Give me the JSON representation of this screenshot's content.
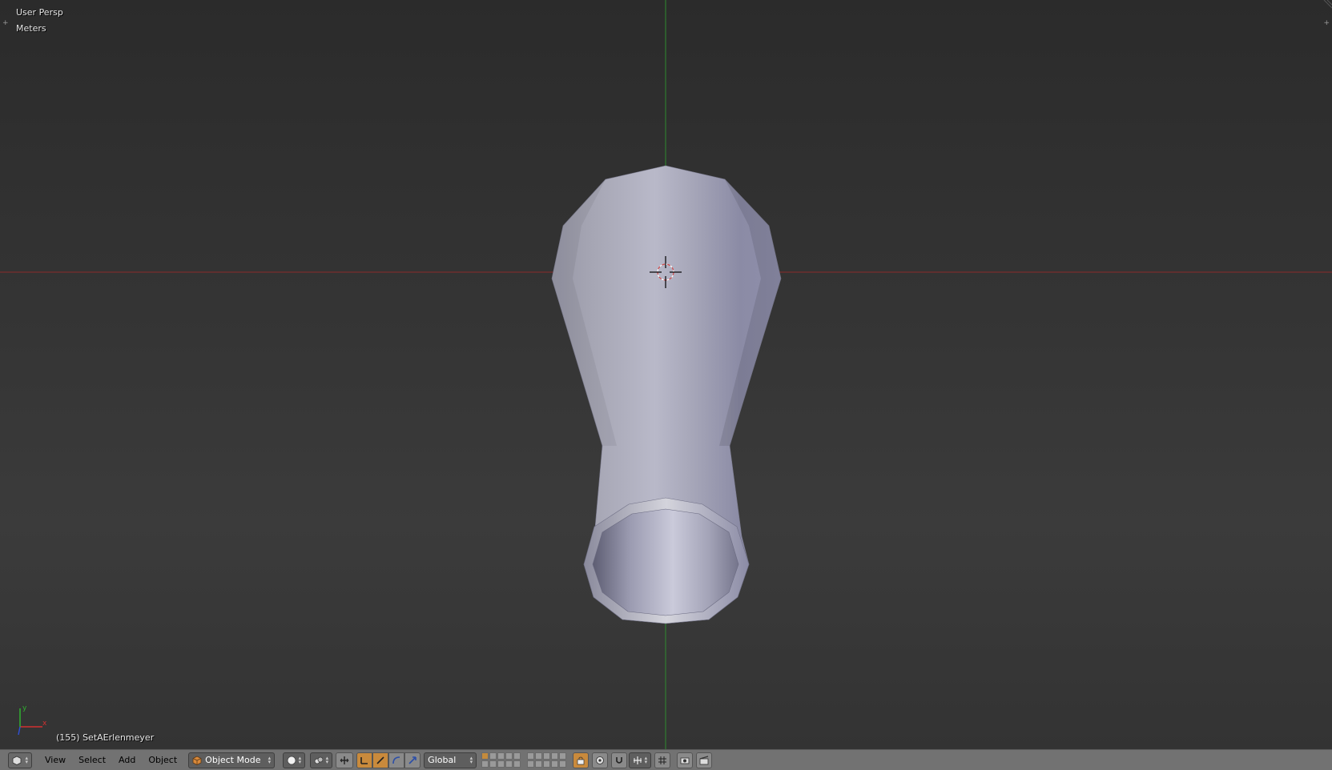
{
  "viewport": {
    "view_name": "User Persp",
    "units": "Meters",
    "object_info": "(155) SetAErlenmeyer",
    "axis_labels": {
      "x": "x",
      "y": "y"
    }
  },
  "header": {
    "menus": [
      "View",
      "Select",
      "Add",
      "Object"
    ],
    "mode": "Object Mode",
    "orientation": "Global"
  },
  "colors": {
    "viewport_bg": "#393939",
    "x_axis": "#8b2b2b",
    "y_axis": "#2f8b2f",
    "header_bg": "#727272",
    "active_button": "#c98a3c",
    "mesh": "#a0a0b8"
  },
  "icons": {
    "editor_type": "3d-view-icon",
    "mode": "cube-icon",
    "shading": "solid-sphere-icon",
    "pivot": "pivot-icon",
    "manipulator": "manipulator-icon",
    "translate": "translate-icon",
    "rotate": "rotate-icon",
    "scale": "scale-icon",
    "layers": "layers-icon",
    "lock": "lock-icon",
    "proportional": "proportional-icon",
    "snap": "magnet-icon",
    "snap_target": "snap-target-icon",
    "render": "camera-icon",
    "render_anim": "clapper-icon"
  }
}
